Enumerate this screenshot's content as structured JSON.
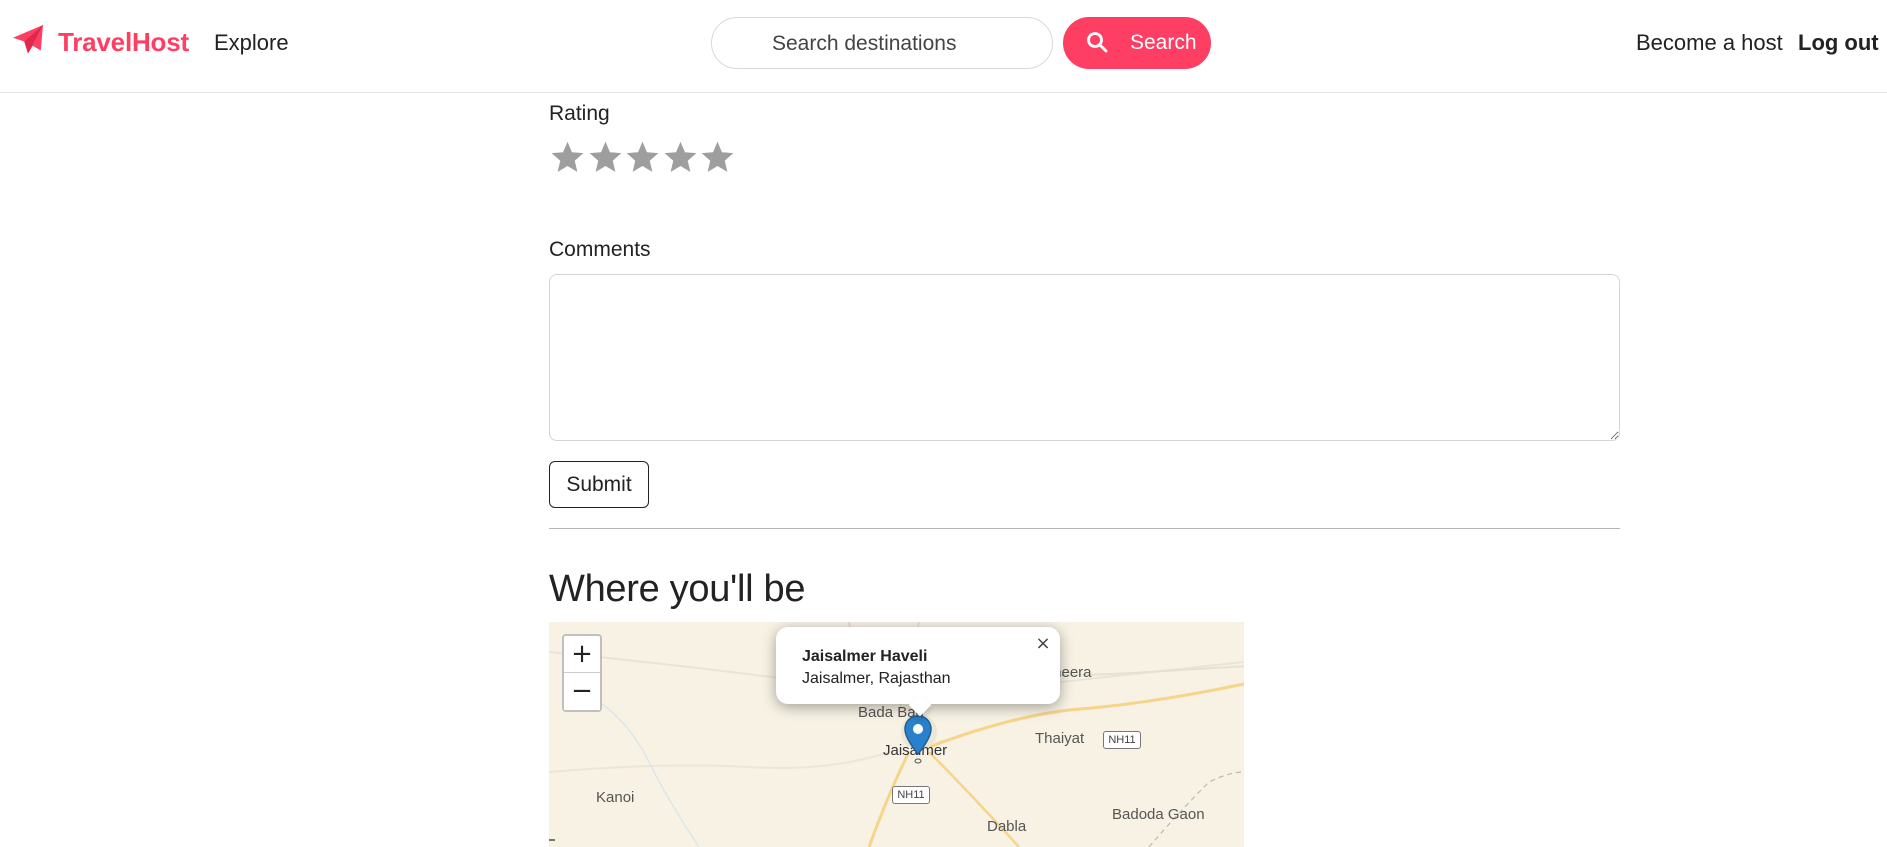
{
  "header": {
    "brand": "TravelHost",
    "nav_explore": "Explore",
    "search_placeholder": "Search destinations",
    "search_button": "Search",
    "nav_host": "Become a host",
    "nav_logout": "Log out",
    "brand_color": "#fe3f63"
  },
  "review": {
    "rating_label": "Rating",
    "rating_value": 0,
    "rating_max": 5,
    "star_color": "#9e9e9e",
    "comments_label": "Comments",
    "comments_value": "",
    "submit_label": "Submit"
  },
  "location": {
    "title": "Where you'll be",
    "zoom_in": "+",
    "zoom_out": "−",
    "popup": {
      "title": "Jaisalmer Haveli",
      "subtitle": "Jaisalmer, Rajasthan",
      "close": "×"
    },
    "map_labels": [
      "Bada Bag",
      "Jaisalmer",
      "Thaiyat",
      "Kanoi",
      "Dabla",
      "Badoda Gaon",
      "meera"
    ],
    "road_shields": [
      "NH11",
      "NH11"
    ],
    "marker_color": "#2a81cb"
  },
  "icons": [
    "paper-plane-icon",
    "search-icon",
    "star-icon",
    "map-marker-icon",
    "close-icon"
  ]
}
